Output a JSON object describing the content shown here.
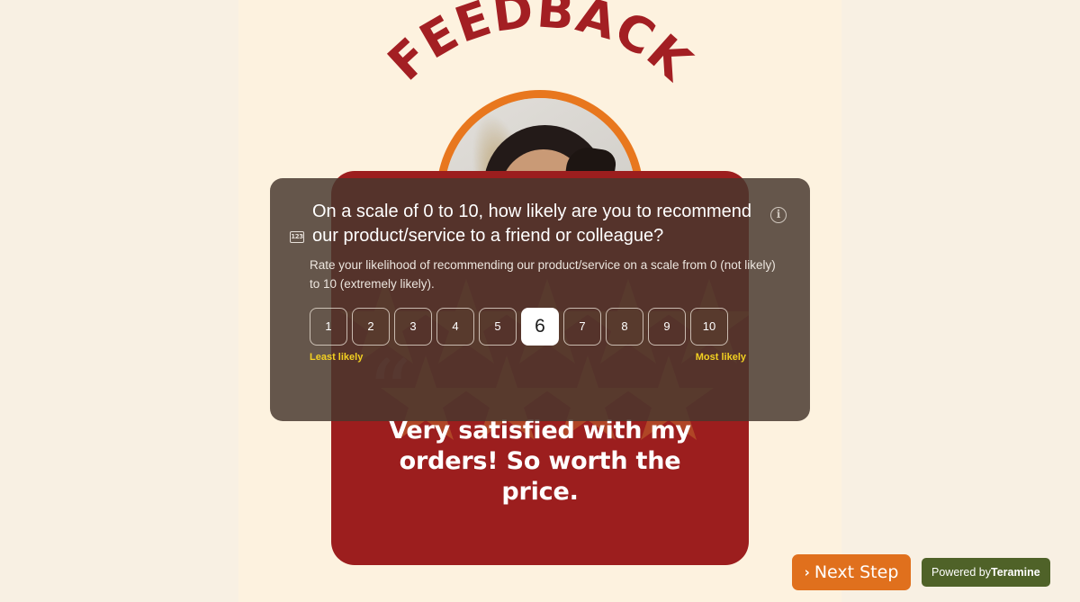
{
  "page": {
    "headline": "FEEDBACK",
    "background_outer": "#f8f0e3",
    "background_band": "#fdf2df",
    "accent_orange": "#e8771e",
    "accent_red": "#9c1e1e",
    "accent_yellow": "#f2d021",
    "panel_color": "#48382f"
  },
  "avatar": {
    "alt": "smiling customer portrait",
    "ring_color": "#e8771e"
  },
  "question": {
    "icon": "123-rating-icon",
    "info_icon": "info-icon",
    "info_glyph": "i",
    "icon_label": "123",
    "title": "On a scale of 0 to 10, how likely are you to recommend our product/service to a friend or colleague?",
    "description": "Rate your likelihood of recommending our product/service on a scale from 0 (not likely) to 10 (extremely likely).",
    "scale": [
      "1",
      "2",
      "3",
      "4",
      "5",
      "6",
      "7",
      "8",
      "9",
      "10"
    ],
    "selected_value": "6",
    "label_low": "Least likely",
    "label_high": "Most likely"
  },
  "testimonial": {
    "quote_glyph": "“",
    "text": "Very satisfied with my orders! So worth the price."
  },
  "footer": {
    "next_step_label": "Next Step",
    "next_step_chevron": "›",
    "powered_prefix": "Powered by",
    "powered_brand": "Teramine"
  }
}
